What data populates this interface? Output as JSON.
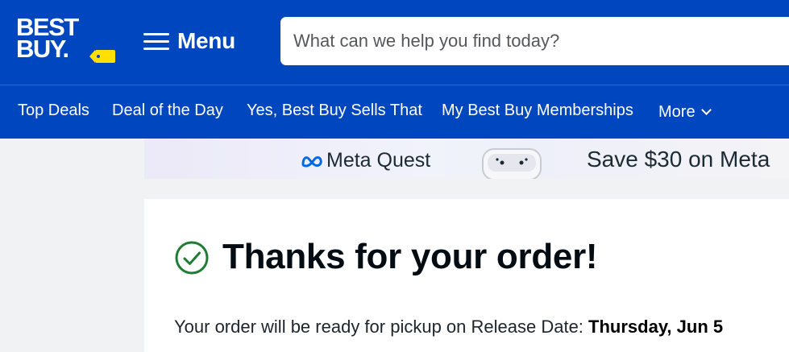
{
  "header": {
    "logo": {
      "line1": "BEST",
      "line2": "BUY."
    },
    "menu_label": "Menu",
    "search_placeholder": "What can we help you find today?"
  },
  "nav": {
    "items": [
      {
        "label": "Top Deals"
      },
      {
        "label": "Deal of the Day"
      },
      {
        "label": "Yes, Best Buy Sells That"
      },
      {
        "label": "My Best Buy Memberships"
      },
      {
        "label": "More"
      }
    ]
  },
  "banner": {
    "brand": "Meta Quest",
    "promo": "Save $30 on Meta"
  },
  "confirmation": {
    "title": "Thanks for your order!",
    "pickup_text": "Your order will be ready for pickup on Release Date: ",
    "pickup_date": "Thursday, Jun 5"
  },
  "colors": {
    "brand_blue": "#0046be",
    "brand_yellow": "#ffe000",
    "success_green": "#1e7d32"
  }
}
